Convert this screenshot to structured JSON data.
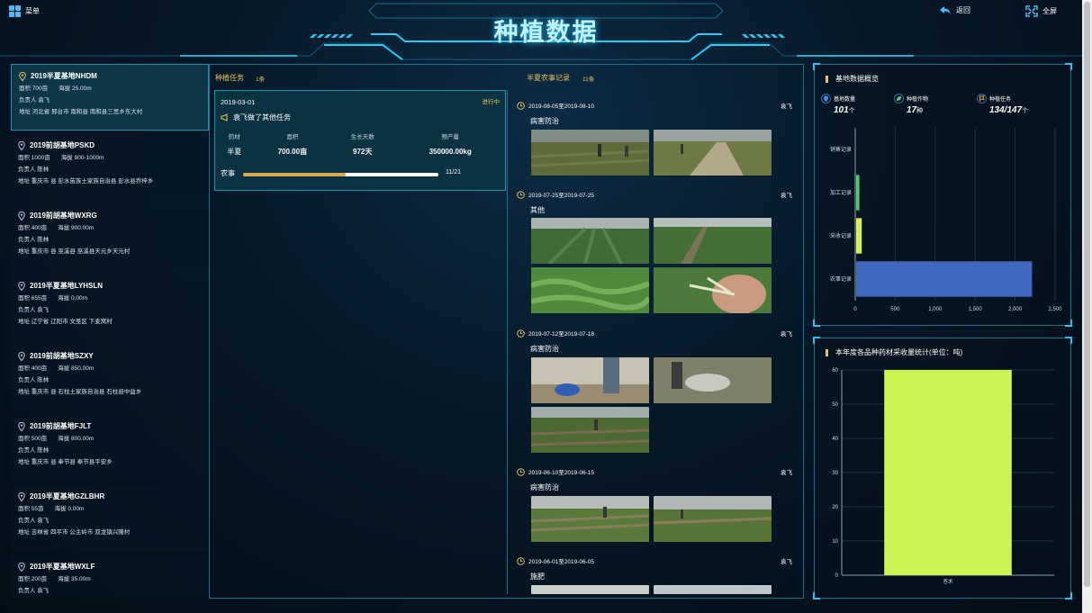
{
  "header": {
    "menu_label": "菜单",
    "title": "种植数据",
    "back_label": "返回",
    "fullscreen_label": "全屏"
  },
  "bases": [
    {
      "name": "2019半夏基地NHDM",
      "area": "面积 700亩",
      "altitude": "海拔 25.00m",
      "owner": "负责人 袁飞",
      "address": "地址 河北省 邢台市 南和县 南和县三思乡东大村"
    },
    {
      "name": "2019前胡基地PSKD",
      "area": "面积 1000亩",
      "altitude": "海拔 800-1000m",
      "owner": "负责人 陈林",
      "address": "地址 重庆市 县 彭水苗族土家族自治县 彭水县乔梓乡"
    },
    {
      "name": "2019前胡基地WXRG",
      "area": "面积 400亩",
      "altitude": "海拔 900.00m",
      "owner": "负责人 陈林",
      "address": "地址 重庆市 县 巫溪县 巫溪县天元乡天元村"
    },
    {
      "name": "2019半夏基地LYHSLN",
      "area": "面积 655亩",
      "altitude": "海拔 0.00m",
      "owner": "负责人 袁飞",
      "address": "地址 辽宁省 辽阳市 文圣区 下麦窝村"
    },
    {
      "name": "2019前胡基地SZXY",
      "area": "面积 400亩",
      "altitude": "海拔 850.00m",
      "owner": "负责人 陈林",
      "address": "地址 重庆市 县 石柱土家族自治县 石柱县中益乡"
    },
    {
      "name": "2019前胡基地FJLT",
      "area": "面积 500亩",
      "altitude": "海拔 800.00m",
      "owner": "负责人 陈林",
      "address": "地址 重庆市 县 奉节县 奉节县平安乡"
    },
    {
      "name": "2019半夏基地GZLBHR",
      "area": "面积 55亩",
      "altitude": "海拔 0.00m",
      "owner": "负责人 袁飞",
      "address": "地址 吉林省 四平市 公主岭市 双龙镇兴隆村"
    },
    {
      "name": "2019半夏基地WXLF",
      "area": "面积 200亩",
      "altitude": "海拔 35.00m",
      "owner": "负责人 袁飞",
      "address": ""
    }
  ],
  "tasks": {
    "heading": "种植任务",
    "count": "1条",
    "item": {
      "date": "2019-03-01",
      "status": "进行中",
      "summary": "袁飞做了其他任务",
      "headers": [
        "药材",
        "面积",
        "生长天数",
        "预产量"
      ],
      "values": [
        "半夏",
        "700.00亩",
        "972天",
        "350000.00kg"
      ],
      "progress_label": "农事",
      "progress_text": "11/21",
      "progress_fraction": 0.524
    }
  },
  "records": {
    "heading": "半夏农事记录",
    "count": "11条",
    "items": [
      {
        "date": "2019-08-05至2019-08-10",
        "person": "袁飞",
        "type": "病害防治",
        "photos": [
          "field-photo",
          "field-photo"
        ]
      },
      {
        "date": "2019-07-25至2019-07-25",
        "person": "袁飞",
        "type": "其他",
        "photos": [
          "field-photo",
          "field-photo",
          "field-photo",
          "plant-in-hand-photo"
        ]
      },
      {
        "date": "2019-07-12至2019-07-18",
        "person": "袁飞",
        "type": "病害防治",
        "photos": [
          "spraying-photo",
          "spraying-photo",
          "field-photo"
        ]
      },
      {
        "date": "2019-06-10至2019-06-15",
        "person": "袁飞",
        "type": "病害防治",
        "photos": [
          "field-photo",
          "field-photo"
        ]
      },
      {
        "date": "2019-06-01至2019-06-05",
        "person": "袁飞",
        "type": "施肥",
        "photos": [
          "field-photo",
          "field-photo"
        ]
      }
    ]
  },
  "overview": {
    "title": "基地数据概览",
    "stats": [
      {
        "label": "基地数量",
        "value": "101",
        "unit": "个",
        "icon": "location-icon",
        "color": "#3b8ce8"
      },
      {
        "label": "种植作物",
        "value": "17",
        "unit": "种",
        "icon": "leaf-icon",
        "color": "#5cc87a"
      },
      {
        "label": "种植任务",
        "value": "134/147",
        "unit": "个",
        "icon": "flag-icon",
        "color": "#e7a23c"
      }
    ]
  },
  "harvest_title": "本年度各品种药材采收量统计(单位：吨)",
  "chart_data": [
    {
      "type": "bar",
      "orientation": "horizontal",
      "categories": [
        "农事记录",
        "采收记录",
        "加工记录",
        "销售记录"
      ],
      "values": [
        2200,
        70,
        40,
        0
      ],
      "colors": [
        "#4068c0",
        "#d8f254",
        "#4ecb71",
        "#4068c0"
      ],
      "xlim": [
        0,
        2500
      ],
      "xticks": [
        "0",
        "500",
        "1,000",
        "1,500",
        "2,000",
        "2,500"
      ]
    },
    {
      "type": "bar",
      "categories": [
        "苍术"
      ],
      "values": [
        60
      ],
      "color": "#cbf552",
      "ylim": [
        0,
        60
      ],
      "yticks": [
        "0",
        "10",
        "20",
        "30",
        "40",
        "50",
        "60"
      ]
    }
  ]
}
